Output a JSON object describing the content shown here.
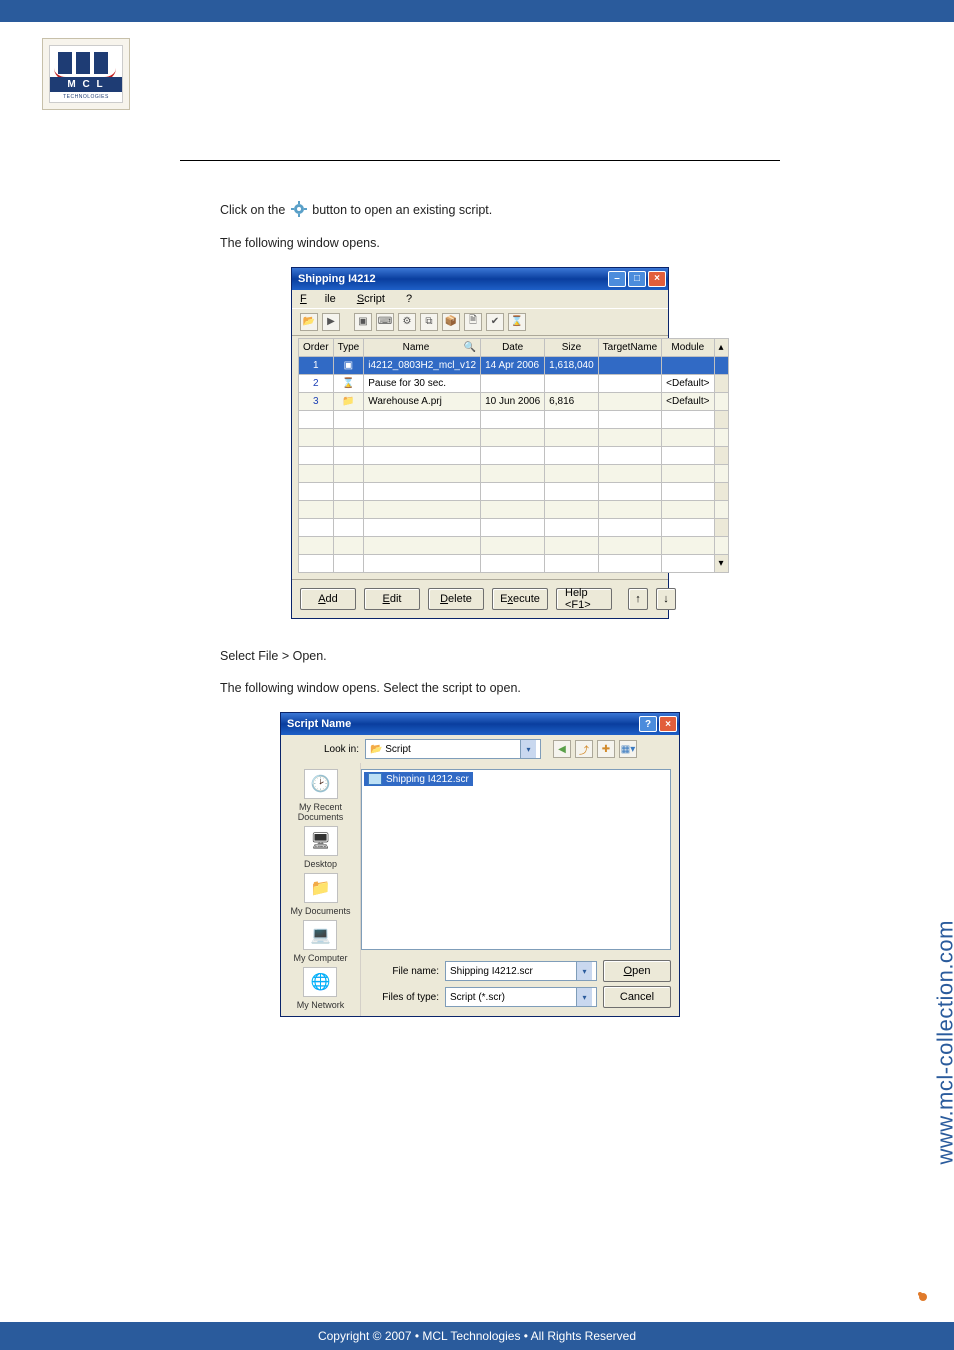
{
  "logo": {
    "letters": "M C L",
    "sub": "TECHNOLOGIES"
  },
  "page": {
    "p1_pre": "Click on the ",
    "p1_post": " button to open an existing script.",
    "p2": "The following window opens."
  },
  "win1": {
    "title": "Shipping I4212",
    "menu": {
      "file": "File",
      "script": "Script",
      "help": "?"
    },
    "columns": [
      "Order",
      "Type",
      "Name",
      "Date",
      "Size",
      "TargetName",
      "Module"
    ],
    "rows": [
      {
        "order": "1",
        "type": "firmware",
        "name": "i4212_0803H2_mcl_v12",
        "date": "14 Apr 2006",
        "size": "1,618,040",
        "target": "",
        "module": ""
      },
      {
        "order": "2",
        "type": "wait",
        "name": "Pause for 30 sec.",
        "date": "",
        "size": "",
        "target": "",
        "module": "<Default>"
      },
      {
        "order": "3",
        "type": "project",
        "name": "Warehouse A.prj",
        "date": "10 Jun 2006",
        "size": "6,816",
        "target": "",
        "module": "<Default>"
      }
    ],
    "buttons": {
      "add": "Add",
      "edit": "Edit",
      "delete": "Delete",
      "execute": "Execute",
      "help": "Help <F1>",
      "up": "↑",
      "down": "↓"
    }
  },
  "page2": {
    "p1": "Select File > Open.",
    "p2": "The following window opens. Select the script to open."
  },
  "dlg": {
    "title": "Script Name",
    "lookin_label": "Look in:",
    "lookin_value": "Script",
    "file_selected": "Shipping I4212.scr",
    "places": [
      "My Recent Documents",
      "Desktop",
      "My Documents",
      "My Computer",
      "My Network"
    ],
    "filename_label": "File name:",
    "filename_value": "Shipping I4212.scr",
    "filetype_label": "Files of type:",
    "filetype_value": "Script (*.scr)",
    "open": "Open",
    "cancel": "Cancel"
  },
  "side_url": "www.mcl-collection.com",
  "footer": "Copyright © 2007 • MCL Technologies • All Rights Reserved"
}
